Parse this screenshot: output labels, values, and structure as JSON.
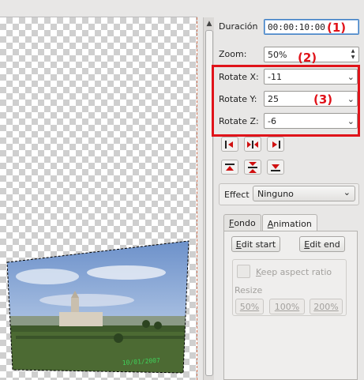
{
  "preview": {
    "photo_timestamp": "10/01/2007"
  },
  "properties": {
    "duration": {
      "label": "Duración",
      "value": "00:00:10:00"
    },
    "zoom": {
      "label": "Zoom:",
      "value": "50%"
    },
    "rotate_x": {
      "label": "Rotate X:",
      "value": "-11"
    },
    "rotate_y": {
      "label": "Rotate Y:",
      "value": "25"
    },
    "rotate_z": {
      "label": "Rotate Z:",
      "value": "-6"
    }
  },
  "annotations": {
    "a1": "(1)",
    "a2": "(2)",
    "a3": "(3)",
    "color": "#e0131a"
  },
  "alignment_buttons": [
    "align-left-icon",
    "align-hcenter-icon",
    "align-right-icon",
    "align-top-icon",
    "align-vcenter-icon",
    "align-bottom-icon"
  ],
  "effect": {
    "label": "Effect",
    "value": "Ninguno"
  },
  "tabs": [
    {
      "label": "Fondo",
      "underline": "F",
      "rest": "ondo"
    },
    {
      "label": "Animation",
      "underline": "A",
      "rest": "nimation"
    }
  ],
  "animation": {
    "edit_start": {
      "label": "Edit start",
      "underline": "E",
      "rest": "dit start"
    },
    "edit_end": {
      "label": "Edit end",
      "underline": "E",
      "rest": "dit end"
    },
    "keep_aspect": {
      "label": "Keep aspect ratio",
      "underline": "K",
      "rest": "eep aspect ratio"
    },
    "resize_label": "Resize",
    "resize_options": [
      "50%",
      "100%",
      "200%"
    ]
  }
}
